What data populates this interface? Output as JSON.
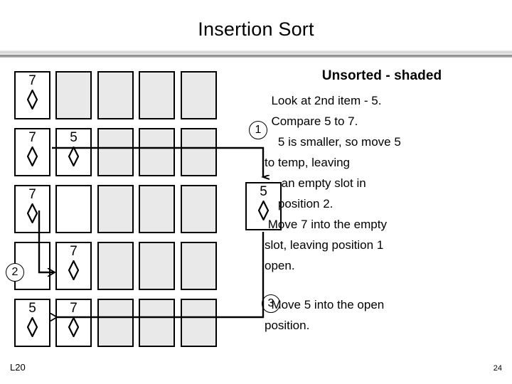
{
  "slide": {
    "title": "Insertion Sort",
    "footer_left": "L20",
    "footer_right": "24"
  },
  "colors": {
    "shaded_card": "#e9e9e9",
    "card_border": "#000000",
    "background": "#ffffff",
    "text": "#000000"
  },
  "grid": {
    "columns": 5,
    "rows": [
      {
        "row": 1,
        "cells": [
          {
            "value": "7",
            "suit": "diamond",
            "shaded": false,
            "empty": false
          },
          {
            "value": "",
            "suit": "",
            "shaded": true,
            "empty": true
          },
          {
            "value": "",
            "suit": "",
            "shaded": true,
            "empty": true
          },
          {
            "value": "",
            "suit": "",
            "shaded": true,
            "empty": true
          },
          {
            "value": "",
            "suit": "",
            "shaded": true,
            "empty": true
          }
        ]
      },
      {
        "row": 2,
        "cells": [
          {
            "value": "7",
            "suit": "diamond",
            "shaded": false,
            "empty": false
          },
          {
            "value": "5",
            "suit": "diamond",
            "shaded": false,
            "empty": false
          },
          {
            "value": "",
            "suit": "",
            "shaded": true,
            "empty": true
          },
          {
            "value": "",
            "suit": "",
            "shaded": true,
            "empty": true
          },
          {
            "value": "",
            "suit": "",
            "shaded": true,
            "empty": true
          }
        ]
      },
      {
        "row": 3,
        "cells": [
          {
            "value": "7",
            "suit": "diamond",
            "shaded": false,
            "empty": false
          },
          {
            "value": "",
            "suit": "",
            "shaded": false,
            "empty": true
          },
          {
            "value": "",
            "suit": "",
            "shaded": true,
            "empty": true
          },
          {
            "value": "",
            "suit": "",
            "shaded": true,
            "empty": true
          },
          {
            "value": "",
            "suit": "",
            "shaded": true,
            "empty": true
          }
        ]
      },
      {
        "row": 4,
        "cells": [
          {
            "value": "",
            "suit": "",
            "shaded": false,
            "empty": true
          },
          {
            "value": "7",
            "suit": "diamond",
            "shaded": false,
            "empty": false
          },
          {
            "value": "",
            "suit": "",
            "shaded": true,
            "empty": true
          },
          {
            "value": "",
            "suit": "",
            "shaded": true,
            "empty": true
          },
          {
            "value": "",
            "suit": "",
            "shaded": true,
            "empty": true
          }
        ]
      },
      {
        "row": 5,
        "cells": [
          {
            "value": "5",
            "suit": "diamond",
            "shaded": false,
            "empty": false
          },
          {
            "value": "7",
            "suit": "diamond",
            "shaded": false,
            "empty": false
          },
          {
            "value": "",
            "suit": "",
            "shaded": true,
            "empty": true
          },
          {
            "value": "",
            "suit": "",
            "shaded": true,
            "empty": true
          },
          {
            "value": "",
            "suit": "",
            "shaded": true,
            "empty": true
          }
        ]
      }
    ]
  },
  "temp_card": {
    "value": "5",
    "suit": "diamond"
  },
  "markers": {
    "one": "1",
    "two": "2",
    "three": "3"
  },
  "notes": {
    "heading": "Unsorted - shaded",
    "lines": [
      "  Look at 2nd item - 5.",
      "  Compare 5 to 7.",
      "    5 is smaller, so move 5",
      "to temp, leaving",
      "     an empty slot in",
      "    position. 2.",
      " Move 7 into the empty",
      "slot, leaving position 1",
      "open."
    ],
    "line_texts": {
      "l1": "  Look at 2nd item - 5.",
      "l2": "  Compare 5 to 7.",
      "l3": "    5 is smaller, so move 5",
      "l4": "to temp, leaving",
      "l5": "     an empty slot in",
      "l6": "    position 2.",
      "l7": " Move 7 into the empty",
      "l8": "slot, leaving position 1",
      "l9": "open."
    }
  },
  "notes2": {
    "line_texts": {
      "l1": "  Move 5 into the open",
      "l2": "position."
    }
  }
}
